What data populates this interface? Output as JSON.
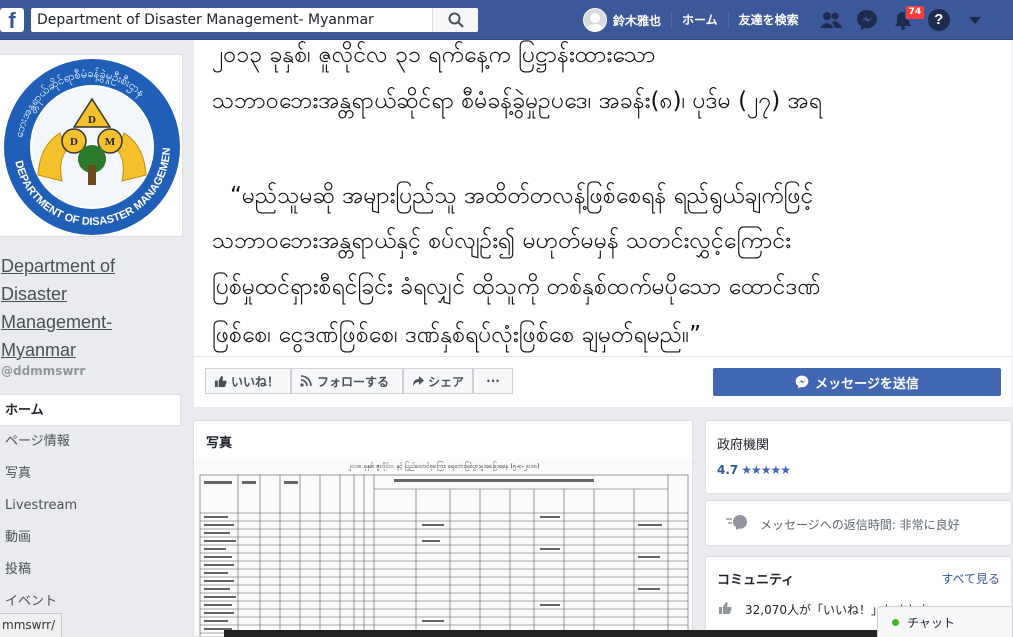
{
  "topbar": {
    "logo_letter": "f",
    "search_value": "Department of Disaster Management- Myanmar",
    "profile_name": "鈴木雅也",
    "links": [
      "ホーム",
      "友達を検索"
    ],
    "notification_count": "74",
    "help_glyph": "?",
    "brand_color": "#3b5998"
  },
  "sidebar": {
    "logo_center": "DDM",
    "logo_ring_text": "DEPARTMENT OF DISASTER MANAGEMENT",
    "page_name": "Department of Disaster Management-Myanmar",
    "handle": "@ddmmswrr",
    "items": [
      {
        "label": "ホーム",
        "active": true
      },
      {
        "label": "ページ情報",
        "active": false
      },
      {
        "label": "写真",
        "active": false
      },
      {
        "label": "Livestream",
        "active": false
      },
      {
        "label": "動画",
        "active": false
      },
      {
        "label": "投稿",
        "active": false
      },
      {
        "label": "イベント",
        "active": false
      }
    ]
  },
  "cover": {
    "lines": [
      "၂၀၁၃ ခုနှစ်၊ ဇူလိုင်လ ၃၁ ရက်နေ့က ပြဋ္ဌာန်းထားသော",
      "သဘာဝဘေးအန္တရာယ်ဆိုင်ရာ စီမံခန့်ခွဲမှုဥပဒေ၊ အခန်း(၈)၊ ပုဒ်မ (၂၇) အရ",
      "“မည်သူမဆို အများပြည်သူ အထိတ်တလန့်ဖြစ်စေရန် ရည်ရွယ်ချက်ဖြင့်",
      "သဘာဝဘေးအန္တရာယ်နှင့် စပ်လျဉ်း၍ မဟုတ်မမှန် သတင်းလွှင့်ကြောင်း",
      "ပြစ်မှုထင်ရှားစီရင်ခြင်း ခံရလျှင် ထိုသူကို တစ်နှစ်ထက်မပိုသော ထောင်ဒဏ်",
      "ဖြစ်စေ၊ ငွေဒဏ်ဖြစ်စေ၊ ဒဏ်နှစ်ရပ်လုံးဖြစ်စေ ချမှတ်ရမည်။”"
    ]
  },
  "actions": {
    "like": "いいね！",
    "follow": "フォローする",
    "share": "シェア",
    "more": "···",
    "message": "メッセージを送信"
  },
  "photos": {
    "title": "写真",
    "doc_heading": "၂၀၁၈ ခုနှစ်၊ ဇူလိုင်လ နှင့် ပြည်ထောင်စုကြေး၊ ရေဘေးဖြစ်ပွားမှုအခြေအနေ (၅-၈-၂၀၁၈)"
  },
  "info": {
    "category": "政府機関",
    "rating": "4.7",
    "response": "メッセージへの返信時間: 非常に良好",
    "community_title": "コミュニティ",
    "see_all": "すべて見る",
    "likes_line": "32,070人が「いいね！」しました"
  },
  "status_url": "mmswrr/",
  "chat": {
    "label": "チャット"
  }
}
